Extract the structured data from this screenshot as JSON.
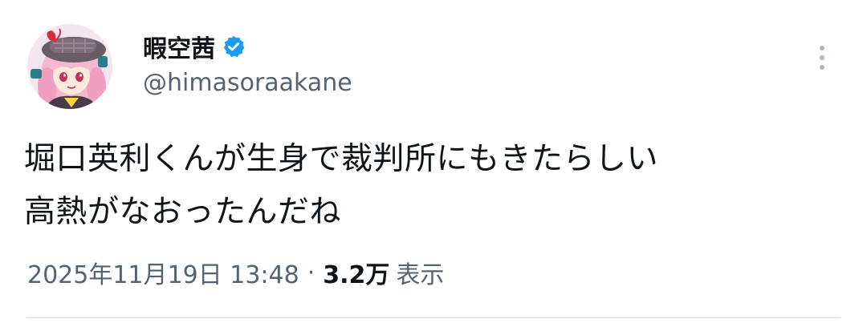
{
  "author": {
    "display_name": "暇空茜",
    "handle": "@himasoraakane",
    "verified": true,
    "avatar_icon": "anime-avatar-icon",
    "verified_icon": "verified-badge-icon"
  },
  "menu": {
    "icon": "more-options-icon"
  },
  "tweet": {
    "text": "堀口英利くんが生身で裁判所にもきたらしい\n高熱がなおったんだね",
    "timestamp": "2025年11月19日 13:48",
    "separator": "·",
    "view_count": "3.2万",
    "view_label": "表示"
  },
  "colors": {
    "text_primary": "#0f1419",
    "text_secondary": "#536471",
    "verified_blue": "#1d9bf0",
    "divider": "#cfd9de"
  }
}
